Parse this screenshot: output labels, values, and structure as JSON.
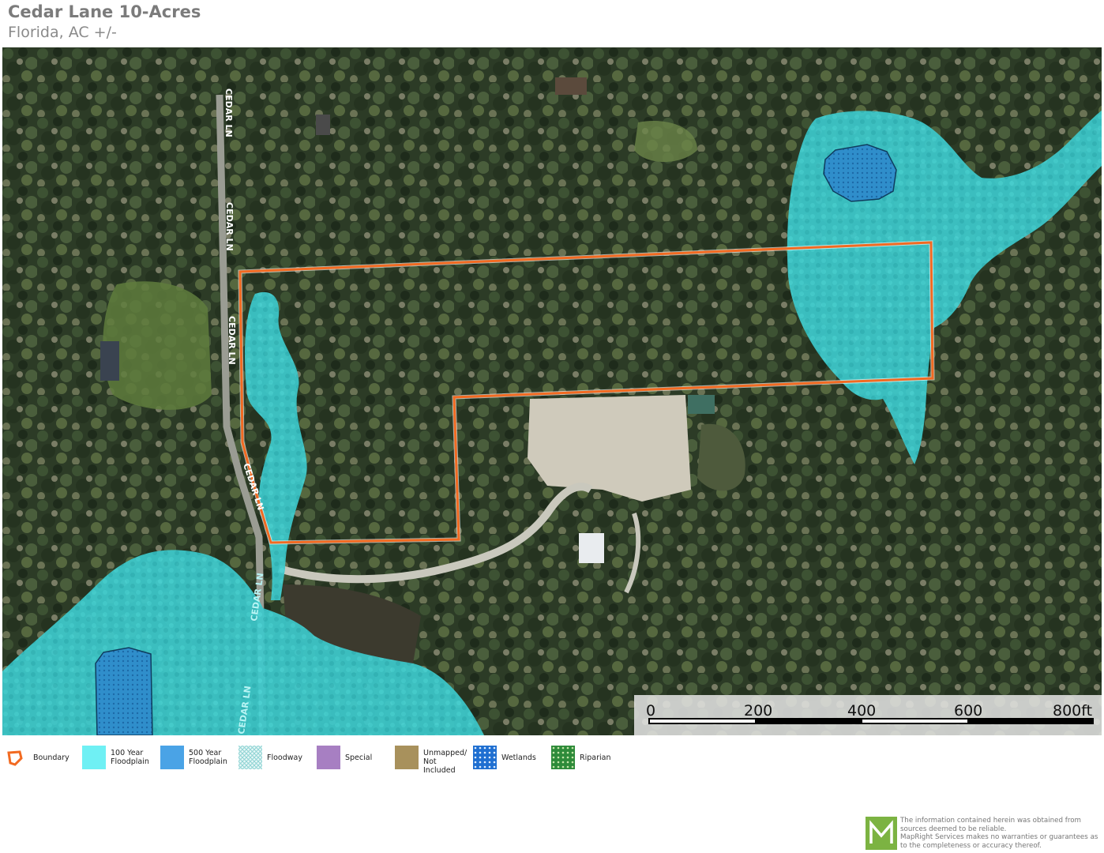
{
  "header": {
    "title": "Cedar Lane 10-Acres",
    "subtitle": "Florida,  AC +/-"
  },
  "map": {
    "road_labels": [
      "CEDAR LN",
      "CEDAR LN",
      "CEDAR LN",
      "CEDAR LN",
      "CEDAR LN",
      "CEDAR LN"
    ],
    "scale_bar": {
      "ticks": [
        "0",
        "200",
        "400",
        "600",
        "800ft"
      ]
    },
    "colors": {
      "boundary": "#f26a21",
      "floodplain_100": "#3fd6d8",
      "floodplain_500": "#4aa3e6",
      "wetlands": "#1f6fd1",
      "riparian": "#2e8b3a",
      "special": "#a77fc2",
      "unmapped": "#a8915c"
    }
  },
  "legend": {
    "items": [
      {
        "label": "Boundary",
        "icon": "boundary-icon"
      },
      {
        "label": "100 Year\nFloodplain",
        "icon": "floodplain-100-swatch"
      },
      {
        "label": "500 Year\nFloodplain",
        "icon": "floodplain-500-swatch"
      },
      {
        "label": "Floodway",
        "icon": "floodway-swatch"
      },
      {
        "label": "Special",
        "icon": "special-swatch"
      },
      {
        "label": "Unmapped/\nNot Included",
        "icon": "unmapped-swatch"
      },
      {
        "label": "Wetlands",
        "icon": "wetlands-swatch"
      },
      {
        "label": "Riparian",
        "icon": "riparian-swatch"
      }
    ]
  },
  "disclaimer": {
    "logo_letter": "M",
    "text": "The information contained herein was obtained from sources deemed to be reliable.\nMapRight Services makes no warranties or guarantees as to the completeness or accuracy thereof."
  }
}
